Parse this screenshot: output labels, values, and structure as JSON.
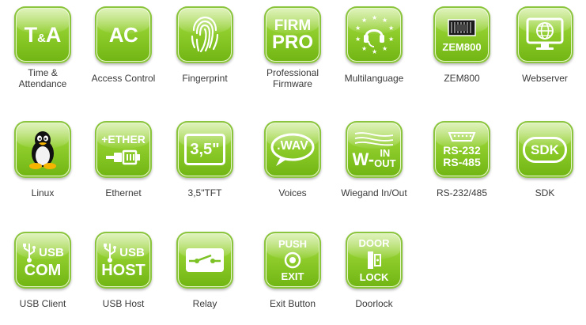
{
  "tiles": [
    {
      "label": "Time &\nAttendance",
      "icon": "time-attendance-icon",
      "glyph_top": "T",
      "glyph_amp": "&",
      "glyph_end": "A"
    },
    {
      "label": "Access Control",
      "icon": "access-control-icon",
      "glyph": "AC"
    },
    {
      "label": "Fingerprint",
      "icon": "fingerprint-icon"
    },
    {
      "label": "Professional\nFirmware",
      "icon": "firmware-pro-icon",
      "glyph_line1": "FIRM",
      "glyph_line2": "PRO"
    },
    {
      "label": "Multilanguage",
      "icon": "headset-stars-icon"
    },
    {
      "label": "ZEM800",
      "icon": "chip-icon",
      "glyph": "ZEM800"
    },
    {
      "label": "Webserver",
      "icon": "monitor-globe-icon"
    },
    {
      "label": "Linux",
      "icon": "tux-penguin-icon"
    },
    {
      "label": "Ethernet",
      "icon": "ethernet-plug-icon",
      "glyph": "+ETHER"
    },
    {
      "label": "3,5\"TFT",
      "icon": "tft-screen-icon",
      "glyph": "3,5\""
    },
    {
      "label": "Voices",
      "icon": "speech-bubble-icon",
      "glyph": ".WAV"
    },
    {
      "label": "Wiegand In/Out",
      "icon": "wiegand-icon",
      "glyph_w": "W-",
      "glyph_in": "IN",
      "glyph_out": "OUT"
    },
    {
      "label": "RS-232/485",
      "icon": "serial-port-icon",
      "glyph_line1": "RS-232",
      "glyph_line2": "RS-485"
    },
    {
      "label": "SDK",
      "icon": "sdk-badge-icon",
      "glyph": "SDK"
    },
    {
      "label": "USB Client",
      "icon": "usb-com-icon",
      "glyph_line1": "USB",
      "glyph_line2": "COM"
    },
    {
      "label": "USB Host",
      "icon": "usb-host-icon",
      "glyph_line1": "USB",
      "glyph_line2": "HOST"
    },
    {
      "label": "Relay",
      "icon": "relay-switch-icon"
    },
    {
      "label": "Exit Button",
      "icon": "push-exit-icon",
      "glyph_line1": "PUSH",
      "glyph_line2": "EXIT"
    },
    {
      "label": "Doorlock",
      "icon": "door-lock-icon",
      "glyph_line1": "DOOR",
      "glyph_line2": "LOCK"
    }
  ],
  "colors": {
    "tile_light": "#b9e46a",
    "tile_dark": "#6fb412",
    "caption": "#3a3a3a"
  }
}
